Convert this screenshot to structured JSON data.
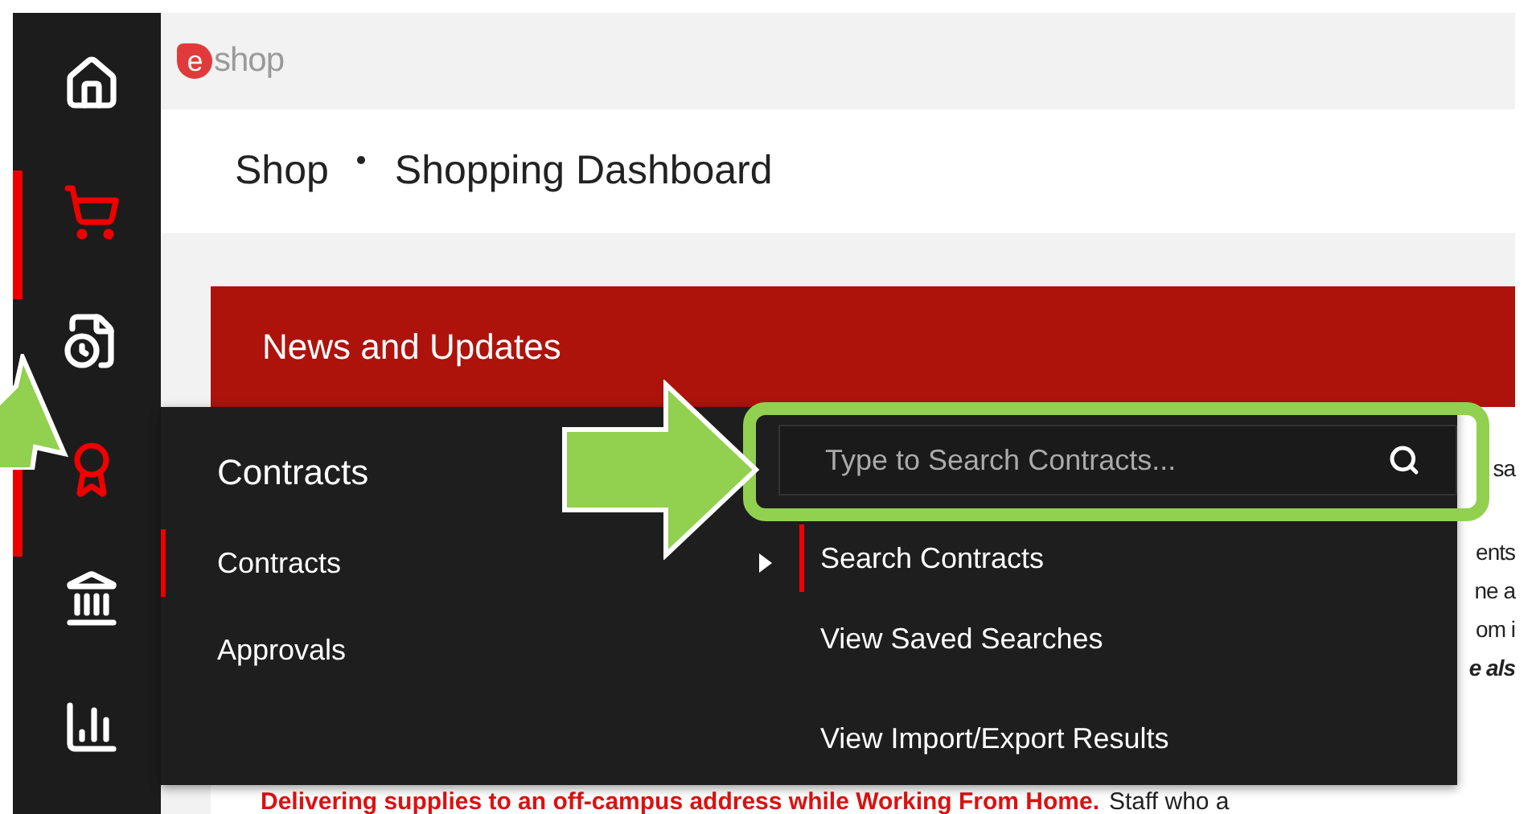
{
  "logo": {
    "mark": "e",
    "text": "shop"
  },
  "breadcrumb": [
    {
      "label": "Shop"
    },
    {
      "label": "Shopping Dashboard"
    }
  ],
  "sidebar": {
    "items": [
      {
        "kind": "home",
        "selected": false
      },
      {
        "kind": "cart",
        "selected": true
      },
      {
        "kind": "document",
        "selected": false
      },
      {
        "kind": "award",
        "selected": true
      },
      {
        "kind": "bank",
        "selected": false
      },
      {
        "kind": "chart",
        "selected": false
      }
    ]
  },
  "banner": {
    "title": "News and Updates"
  },
  "news_fragments": [
    {
      "text": "sa",
      "kind": "plain"
    },
    {
      "text": "ents",
      "kind": "plain"
    },
    {
      "text": "ne a",
      "kind": "plain"
    },
    {
      "text": "om i",
      "kind": "plain"
    },
    {
      "text": "e als",
      "kind": "emphasis"
    }
  ],
  "news_footer": {
    "lead": "Delivering supplies to an off-campus address while Working From Home.",
    "rest": "Staff who a"
  },
  "menu": {
    "title": "Contracts",
    "items": [
      {
        "label": "Contracts",
        "selected": true
      },
      {
        "label": "Approvals",
        "selected": false
      }
    ],
    "search": {
      "placeholder": "Type to Search Contracts..."
    },
    "submenu": [
      {
        "label": "Search Contracts",
        "selected": true
      },
      {
        "label": "View Saved Searches",
        "selected": false
      },
      {
        "label": "View Import/Export Results",
        "selected": false
      }
    ]
  }
}
